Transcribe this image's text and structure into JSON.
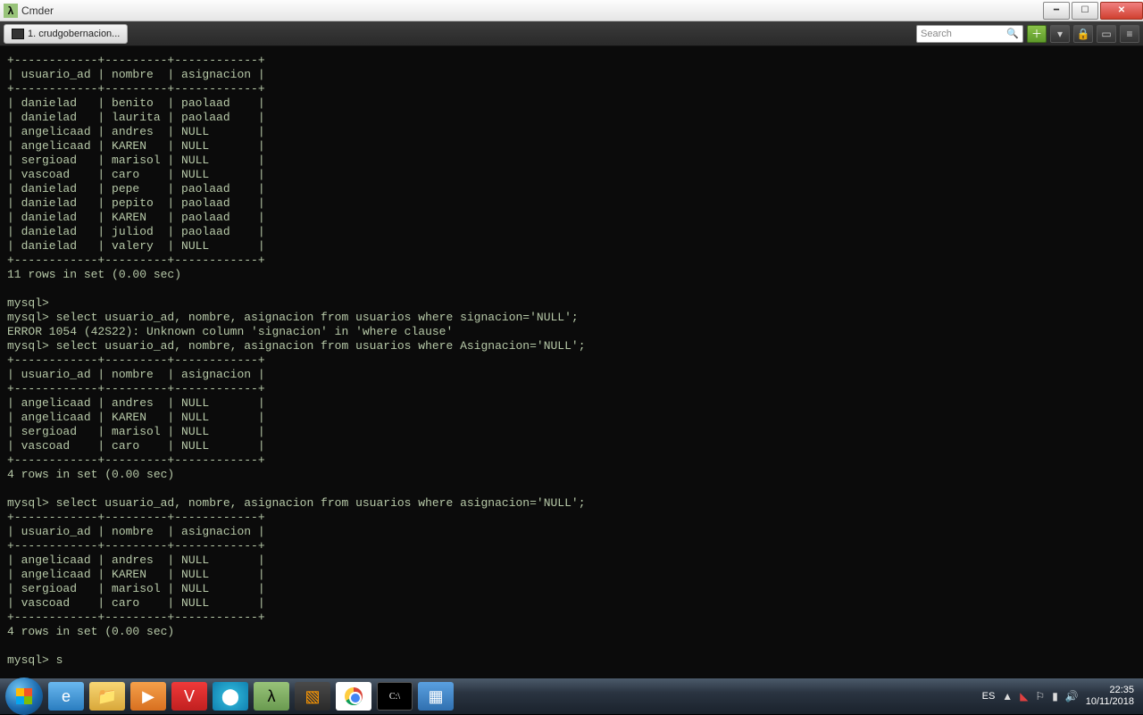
{
  "window": {
    "title": "Cmder"
  },
  "tab": {
    "label": "1. crudgobernacion..."
  },
  "search": {
    "placeholder": "Search"
  },
  "tray": {
    "lang": "ES",
    "time": "22:35",
    "date": "10/11/2018"
  },
  "terminal": {
    "headers": [
      "usuario_ad",
      "nombre",
      "asignacion"
    ],
    "rows1": [
      [
        "danielad",
        "benito",
        "paolaad"
      ],
      [
        "danielad",
        "laurita",
        "paolaad"
      ],
      [
        "angelicaad",
        "andres",
        "NULL"
      ],
      [
        "angelicaad",
        "KAREN",
        "NULL"
      ],
      [
        "sergioad",
        "marisol",
        "NULL"
      ],
      [
        "vascoad",
        "caro",
        "NULL"
      ],
      [
        "danielad",
        "pepe",
        "paolaad"
      ],
      [
        "danielad",
        "pepito",
        "paolaad"
      ],
      [
        "danielad",
        "KAREN",
        "paolaad"
      ],
      [
        "danielad",
        "juliod",
        "paolaad"
      ],
      [
        "danielad",
        "valery",
        "NULL"
      ]
    ],
    "summary1": "11 rows in set (0.00 sec)",
    "query2": "mysql> select usuario_ad, nombre, asignacion from usuarios where signacion='NULL';",
    "error2": "ERROR 1054 (42S22): Unknown column 'signacion' in 'where clause'",
    "query3": "mysql> select usuario_ad, nombre, asignacion from usuarios where Asignacion='NULL';",
    "rows3": [
      [
        "angelicaad",
        "andres",
        "NULL"
      ],
      [
        "angelicaad",
        "KAREN",
        "NULL"
      ],
      [
        "sergioad",
        "marisol",
        "NULL"
      ],
      [
        "vascoad",
        "caro",
        "NULL"
      ]
    ],
    "summary3": "4 rows in set (0.00 sec)",
    "query4": "mysql> select usuario_ad, nombre, asignacion from usuarios where asignacion='NULL';",
    "summary4": "4 rows in set (0.00 sec)",
    "prompt": "mysql> s"
  }
}
